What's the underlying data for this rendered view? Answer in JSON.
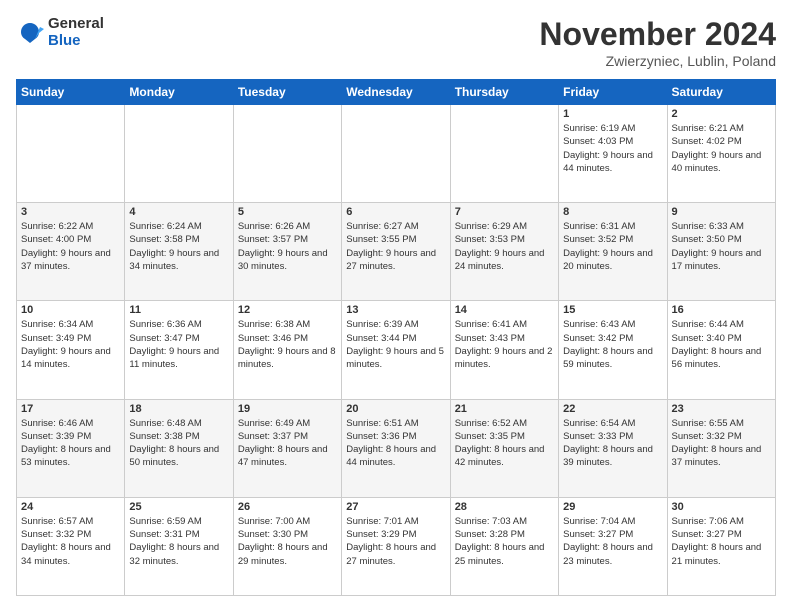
{
  "logo": {
    "general": "General",
    "blue": "Blue"
  },
  "header": {
    "month": "November 2024",
    "location": "Zwierzyniec, Lublin, Poland"
  },
  "weekdays": [
    "Sunday",
    "Monday",
    "Tuesday",
    "Wednesday",
    "Thursday",
    "Friday",
    "Saturday"
  ],
  "weeks": [
    [
      {
        "day": "",
        "info": ""
      },
      {
        "day": "",
        "info": ""
      },
      {
        "day": "",
        "info": ""
      },
      {
        "day": "",
        "info": ""
      },
      {
        "day": "",
        "info": ""
      },
      {
        "day": "1",
        "info": "Sunrise: 6:19 AM\nSunset: 4:03 PM\nDaylight: 9 hours\nand 44 minutes."
      },
      {
        "day": "2",
        "info": "Sunrise: 6:21 AM\nSunset: 4:02 PM\nDaylight: 9 hours\nand 40 minutes."
      }
    ],
    [
      {
        "day": "3",
        "info": "Sunrise: 6:22 AM\nSunset: 4:00 PM\nDaylight: 9 hours\nand 37 minutes."
      },
      {
        "day": "4",
        "info": "Sunrise: 6:24 AM\nSunset: 3:58 PM\nDaylight: 9 hours\nand 34 minutes."
      },
      {
        "day": "5",
        "info": "Sunrise: 6:26 AM\nSunset: 3:57 PM\nDaylight: 9 hours\nand 30 minutes."
      },
      {
        "day": "6",
        "info": "Sunrise: 6:27 AM\nSunset: 3:55 PM\nDaylight: 9 hours\nand 27 minutes."
      },
      {
        "day": "7",
        "info": "Sunrise: 6:29 AM\nSunset: 3:53 PM\nDaylight: 9 hours\nand 24 minutes."
      },
      {
        "day": "8",
        "info": "Sunrise: 6:31 AM\nSunset: 3:52 PM\nDaylight: 9 hours\nand 20 minutes."
      },
      {
        "day": "9",
        "info": "Sunrise: 6:33 AM\nSunset: 3:50 PM\nDaylight: 9 hours\nand 17 minutes."
      }
    ],
    [
      {
        "day": "10",
        "info": "Sunrise: 6:34 AM\nSunset: 3:49 PM\nDaylight: 9 hours\nand 14 minutes."
      },
      {
        "day": "11",
        "info": "Sunrise: 6:36 AM\nSunset: 3:47 PM\nDaylight: 9 hours\nand 11 minutes."
      },
      {
        "day": "12",
        "info": "Sunrise: 6:38 AM\nSunset: 3:46 PM\nDaylight: 9 hours\nand 8 minutes."
      },
      {
        "day": "13",
        "info": "Sunrise: 6:39 AM\nSunset: 3:44 PM\nDaylight: 9 hours\nand 5 minutes."
      },
      {
        "day": "14",
        "info": "Sunrise: 6:41 AM\nSunset: 3:43 PM\nDaylight: 9 hours\nand 2 minutes."
      },
      {
        "day": "15",
        "info": "Sunrise: 6:43 AM\nSunset: 3:42 PM\nDaylight: 8 hours\nand 59 minutes."
      },
      {
        "day": "16",
        "info": "Sunrise: 6:44 AM\nSunset: 3:40 PM\nDaylight: 8 hours\nand 56 minutes."
      }
    ],
    [
      {
        "day": "17",
        "info": "Sunrise: 6:46 AM\nSunset: 3:39 PM\nDaylight: 8 hours\nand 53 minutes."
      },
      {
        "day": "18",
        "info": "Sunrise: 6:48 AM\nSunset: 3:38 PM\nDaylight: 8 hours\nand 50 minutes."
      },
      {
        "day": "19",
        "info": "Sunrise: 6:49 AM\nSunset: 3:37 PM\nDaylight: 8 hours\nand 47 minutes."
      },
      {
        "day": "20",
        "info": "Sunrise: 6:51 AM\nSunset: 3:36 PM\nDaylight: 8 hours\nand 44 minutes."
      },
      {
        "day": "21",
        "info": "Sunrise: 6:52 AM\nSunset: 3:35 PM\nDaylight: 8 hours\nand 42 minutes."
      },
      {
        "day": "22",
        "info": "Sunrise: 6:54 AM\nSunset: 3:33 PM\nDaylight: 8 hours\nand 39 minutes."
      },
      {
        "day": "23",
        "info": "Sunrise: 6:55 AM\nSunset: 3:32 PM\nDaylight: 8 hours\nand 37 minutes."
      }
    ],
    [
      {
        "day": "24",
        "info": "Sunrise: 6:57 AM\nSunset: 3:32 PM\nDaylight: 8 hours\nand 34 minutes."
      },
      {
        "day": "25",
        "info": "Sunrise: 6:59 AM\nSunset: 3:31 PM\nDaylight: 8 hours\nand 32 minutes."
      },
      {
        "day": "26",
        "info": "Sunrise: 7:00 AM\nSunset: 3:30 PM\nDaylight: 8 hours\nand 29 minutes."
      },
      {
        "day": "27",
        "info": "Sunrise: 7:01 AM\nSunset: 3:29 PM\nDaylight: 8 hours\nand 27 minutes."
      },
      {
        "day": "28",
        "info": "Sunrise: 7:03 AM\nSunset: 3:28 PM\nDaylight: 8 hours\nand 25 minutes."
      },
      {
        "day": "29",
        "info": "Sunrise: 7:04 AM\nSunset: 3:27 PM\nDaylight: 8 hours\nand 23 minutes."
      },
      {
        "day": "30",
        "info": "Sunrise: 7:06 AM\nSunset: 3:27 PM\nDaylight: 8 hours\nand 21 minutes."
      }
    ]
  ]
}
